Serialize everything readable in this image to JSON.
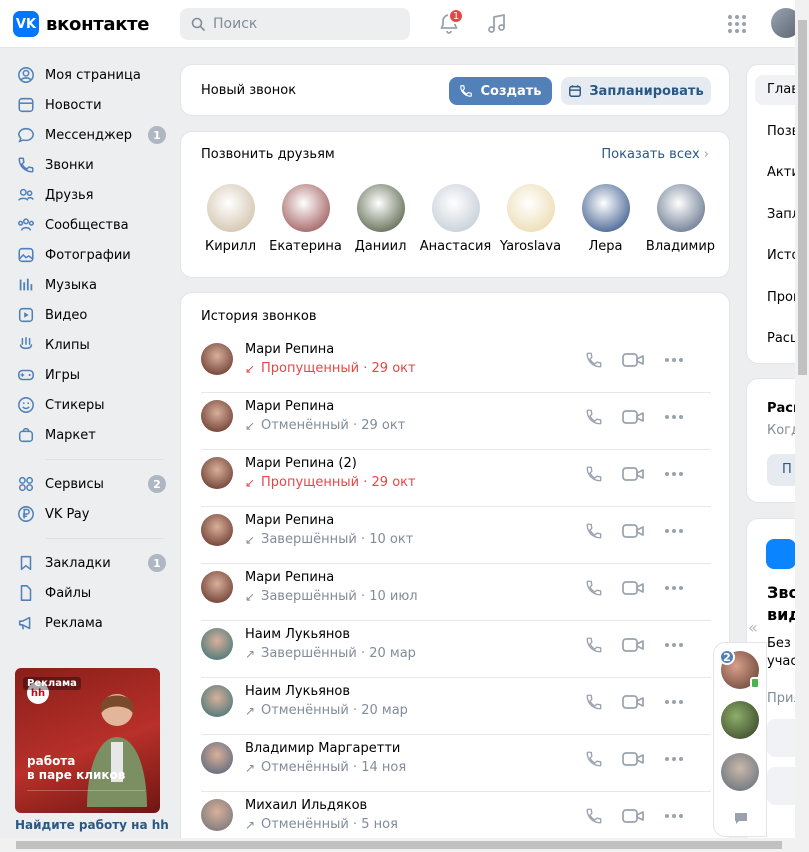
{
  "header": {
    "logo_text": "вконтакте",
    "logo_mark": "VK",
    "search_placeholder": "Поиск",
    "notifications_count": "1"
  },
  "nav": {
    "items": [
      {
        "label": "Моя страница",
        "icon": "user-circle-icon"
      },
      {
        "label": "Новости",
        "icon": "newspaper-icon"
      },
      {
        "label": "Мессенджер",
        "icon": "message-icon",
        "badge": "1"
      },
      {
        "label": "Звонки",
        "icon": "phone-icon"
      },
      {
        "label": "Друзья",
        "icon": "friends-icon"
      },
      {
        "label": "Сообщества",
        "icon": "communities-icon"
      },
      {
        "label": "Фотографии",
        "icon": "photo-icon"
      },
      {
        "label": "Музыка",
        "icon": "music-icon"
      },
      {
        "label": "Видео",
        "icon": "video-icon"
      },
      {
        "label": "Клипы",
        "icon": "clips-icon"
      },
      {
        "label": "Игры",
        "icon": "gamepad-icon"
      },
      {
        "label": "Стикеры",
        "icon": "smile-icon"
      },
      {
        "label": "Маркет",
        "icon": "bag-icon"
      }
    ],
    "items2": [
      {
        "label": "Сервисы",
        "icon": "services-icon",
        "badge": "2"
      },
      {
        "label": "VK Pay",
        "icon": "ruble-icon"
      }
    ],
    "items3": [
      {
        "label": "Закладки",
        "icon": "bookmark-icon",
        "badge": "1"
      },
      {
        "label": "Файлы",
        "icon": "file-icon"
      },
      {
        "label": "Реклама",
        "icon": "megaphone-icon"
      }
    ]
  },
  "ad": {
    "label": "Реклама",
    "brand": "hh",
    "headline_line1": "работа",
    "headline_line2": "в паре кликов",
    "caption": "Найдите работу на hh"
  },
  "new_call": {
    "label": "Новый звонок",
    "create": "Создать",
    "schedule": "Запланировать"
  },
  "friends": {
    "title": "Позвонить друзьям",
    "show_all": "Показать всех",
    "list": [
      {
        "name": "Кирилл",
        "color": "#c9b79c"
      },
      {
        "name": "Екатерина",
        "color": "#8e3c3c"
      },
      {
        "name": "Даниил",
        "color": "#3b4a2a"
      },
      {
        "name": "Анастасия",
        "color": "#b9c3cf"
      },
      {
        "name": "Yaroslava",
        "color": "#e8d5a3"
      },
      {
        "name": "Лера",
        "color": "#1b3f7a"
      },
      {
        "name": "Владимир",
        "color": "#4a5d78"
      }
    ]
  },
  "history": {
    "title": "История звонков",
    "rows": [
      {
        "name": "Мари Репина",
        "status": "Пропущенный · 29 окт",
        "type": "missed",
        "arrow": "↙",
        "color": "#5a2a22"
      },
      {
        "name": "Мари Репина",
        "status": "Отменённый · 29 окт",
        "type": "normal",
        "arrow": "↙",
        "color": "#5a2a22"
      },
      {
        "name": "Мари Репина (2)",
        "status": "Пропущенный · 29 окт",
        "type": "missed",
        "arrow": "↙",
        "color": "#5a2a22"
      },
      {
        "name": "Мари Репина",
        "status": "Завершённый · 10 окт",
        "type": "normal",
        "arrow": "↙",
        "color": "#5a2a22"
      },
      {
        "name": "Мари Репина",
        "status": "Завершённый · 10 июл",
        "type": "normal",
        "arrow": "↙",
        "color": "#5a2a22"
      },
      {
        "name": "Наим Лукьянов",
        "status": "Завершённый · 20 мар",
        "type": "normal",
        "arrow": "↗",
        "color": "#2f6e74"
      },
      {
        "name": "Наим Лукьянов",
        "status": "Отменённый · 20 мар",
        "type": "normal",
        "arrow": "↗",
        "color": "#2f6e74"
      },
      {
        "name": "Владимир Маргаретти",
        "status": "Отменённый · 14 ноя",
        "type": "normal",
        "arrow": "↗",
        "color": "#4a5d78"
      },
      {
        "name": "Михаил Ильдяков",
        "status": "Отменённый · 5 ноя",
        "type": "normal",
        "arrow": "↗",
        "color": "#6b6f78"
      }
    ]
  },
  "right": {
    "menu": [
      "Глав",
      "Позв",
      "Акти",
      "Запл",
      "Исто",
      "Прош",
      "Расш"
    ],
    "card2_title": "Расш",
    "card2_sub": "Когд",
    "card2_btn": "П",
    "card3_title1": "Зво",
    "card3_title2": "вид",
    "card3_text1": "Без",
    "card3_text2": "учас",
    "card3_link": "Прил"
  },
  "chatbar": {
    "badge": "2"
  },
  "colors": {
    "accent": "#5181b8",
    "link": "#2a5885",
    "missed": "#e64646",
    "muted": "#818c99"
  }
}
